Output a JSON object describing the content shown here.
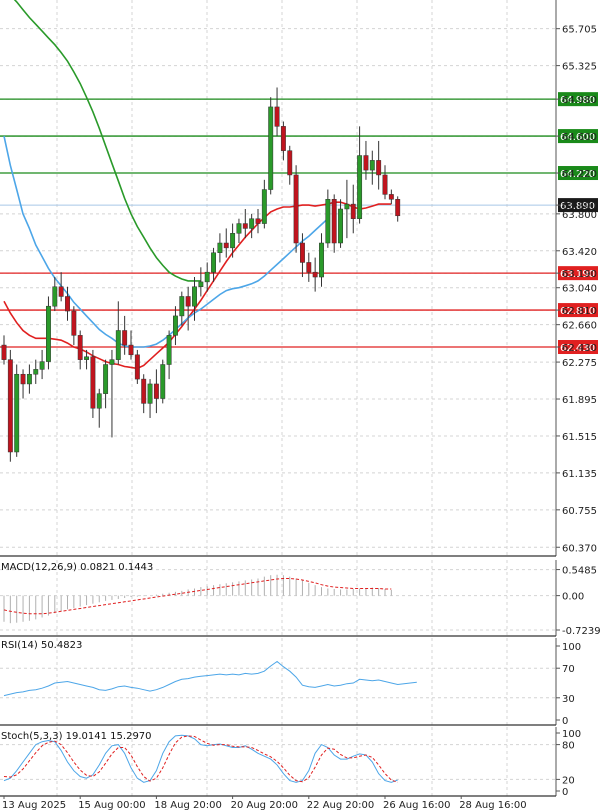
{
  "chart_data": [
    {
      "type": "candlestick",
      "pane": "price",
      "y_ticks": [
        65.705,
        65.325,
        64.98,
        64.6,
        64.22,
        63.89,
        63.8,
        63.42,
        63.19,
        63.04,
        62.81,
        62.66,
        62.43,
        62.275,
        61.895,
        61.515,
        61.135,
        60.755,
        60.37
      ],
      "y_tick_labels": [
        "65.705",
        "65.325",
        "64.980",
        "64.600",
        "64.220",
        "63.890",
        "63.800",
        "63.420",
        "63.190",
        "63.040",
        "62.810",
        "62.660",
        "62.430",
        "62.275",
        "61.895",
        "61.515",
        "61.135",
        "60.755",
        "60.370"
      ],
      "ylim": [
        60.28,
        66.0
      ],
      "x_labels": [
        "13 Aug 2025",
        "15 Aug 00:00",
        "18 Aug 20:00",
        "20 Aug 20:00",
        "22 Aug 20:00",
        "26 Aug 16:00",
        "28 Aug 16:00"
      ],
      "x_label_index": [
        0,
        12,
        24,
        36,
        48,
        60,
        72
      ],
      "levels": [
        {
          "value": 64.98,
          "label": "64.980",
          "color": "#1a8a1a"
        },
        {
          "value": 64.6,
          "label": "64.600",
          "color": "#1a8a1a"
        },
        {
          "value": 64.22,
          "label": "64.220",
          "color": "#1a8a1a"
        },
        {
          "value": 63.19,
          "label": "63.190",
          "color": "#e02020"
        },
        {
          "value": 62.81,
          "label": "62.810",
          "color": "#e02020"
        },
        {
          "value": 62.43,
          "label": "62.430",
          "color": "#e02020"
        }
      ],
      "current_price": {
        "value": 63.89,
        "label": "63.890"
      },
      "candles": [
        {
          "o": 62.45,
          "h": 62.55,
          "l": 62.25,
          "c": 62.3
        },
        {
          "o": 62.3,
          "h": 62.4,
          "l": 61.25,
          "c": 61.35
        },
        {
          "o": 61.35,
          "h": 62.25,
          "l": 61.3,
          "c": 62.15
        },
        {
          "o": 62.15,
          "h": 62.2,
          "l": 61.9,
          "c": 62.05
        },
        {
          "o": 62.05,
          "h": 62.25,
          "l": 61.95,
          "c": 62.15
        },
        {
          "o": 62.15,
          "h": 62.3,
          "l": 62.05,
          "c": 62.2
        },
        {
          "o": 62.2,
          "h": 62.4,
          "l": 62.1,
          "c": 62.28
        },
        {
          "o": 62.28,
          "h": 62.95,
          "l": 62.2,
          "c": 62.85
        },
        {
          "o": 62.85,
          "h": 63.15,
          "l": 62.8,
          "c": 63.05
        },
        {
          "o": 63.05,
          "h": 63.2,
          "l": 62.9,
          "c": 62.95
        },
        {
          "o": 62.95,
          "h": 63.05,
          "l": 62.7,
          "c": 62.8
        },
        {
          "o": 62.8,
          "h": 62.85,
          "l": 62.45,
          "c": 62.55
        },
        {
          "o": 62.55,
          "h": 62.6,
          "l": 62.2,
          "c": 62.3
        },
        {
          "o": 62.3,
          "h": 62.4,
          "l": 62.2,
          "c": 62.33
        },
        {
          "o": 62.33,
          "h": 62.4,
          "l": 61.7,
          "c": 61.8
        },
        {
          "o": 61.8,
          "h": 62.0,
          "l": 61.6,
          "c": 61.95
        },
        {
          "o": 61.95,
          "h": 62.3,
          "l": 61.8,
          "c": 62.25
        },
        {
          "o": 62.25,
          "h": 62.4,
          "l": 61.5,
          "c": 62.3
        },
        {
          "o": 62.3,
          "h": 62.9,
          "l": 62.25,
          "c": 62.6
        },
        {
          "o": 62.6,
          "h": 62.75,
          "l": 62.35,
          "c": 62.45
        },
        {
          "o": 62.45,
          "h": 62.6,
          "l": 62.3,
          "c": 62.35
        },
        {
          "o": 62.35,
          "h": 62.4,
          "l": 62.05,
          "c": 62.1
        },
        {
          "o": 62.1,
          "h": 62.15,
          "l": 61.75,
          "c": 61.85
        },
        {
          "o": 61.85,
          "h": 62.1,
          "l": 61.7,
          "c": 62.05
        },
        {
          "o": 62.05,
          "h": 62.2,
          "l": 61.75,
          "c": 61.9
        },
        {
          "o": 61.9,
          "h": 62.3,
          "l": 61.85,
          "c": 62.25
        },
        {
          "o": 62.25,
          "h": 62.6,
          "l": 62.1,
          "c": 62.55
        },
        {
          "o": 62.55,
          "h": 62.85,
          "l": 62.45,
          "c": 62.75
        },
        {
          "o": 62.75,
          "h": 63.0,
          "l": 62.65,
          "c": 62.95
        },
        {
          "o": 62.95,
          "h": 63.05,
          "l": 62.6,
          "c": 62.85
        },
        {
          "o": 62.85,
          "h": 63.15,
          "l": 62.7,
          "c": 63.05
        },
        {
          "o": 63.05,
          "h": 63.25,
          "l": 62.95,
          "c": 63.1
        },
        {
          "o": 63.1,
          "h": 63.3,
          "l": 63.0,
          "c": 63.2
        },
        {
          "o": 63.2,
          "h": 63.45,
          "l": 63.1,
          "c": 63.4
        },
        {
          "o": 63.4,
          "h": 63.6,
          "l": 63.3,
          "c": 63.5
        },
        {
          "o": 63.5,
          "h": 63.65,
          "l": 63.35,
          "c": 63.45
        },
        {
          "o": 63.45,
          "h": 63.7,
          "l": 63.35,
          "c": 63.6
        },
        {
          "o": 63.6,
          "h": 63.75,
          "l": 63.5,
          "c": 63.7
        },
        {
          "o": 63.7,
          "h": 63.85,
          "l": 63.55,
          "c": 63.65
        },
        {
          "o": 63.65,
          "h": 63.8,
          "l": 63.55,
          "c": 63.75
        },
        {
          "o": 63.75,
          "h": 63.85,
          "l": 63.6,
          "c": 63.7
        },
        {
          "o": 63.7,
          "h": 64.15,
          "l": 63.65,
          "c": 64.05
        },
        {
          "o": 64.05,
          "h": 65.0,
          "l": 64.0,
          "c": 64.9
        },
        {
          "o": 64.9,
          "h": 65.1,
          "l": 64.6,
          "c": 64.7
        },
        {
          "o": 64.7,
          "h": 64.75,
          "l": 64.35,
          "c": 64.45
        },
        {
          "o": 64.45,
          "h": 64.5,
          "l": 64.1,
          "c": 64.2
        },
        {
          "o": 64.2,
          "h": 64.3,
          "l": 63.4,
          "c": 63.5
        },
        {
          "o": 63.5,
          "h": 63.6,
          "l": 63.15,
          "c": 63.3
        },
        {
          "o": 63.3,
          "h": 63.4,
          "l": 63.1,
          "c": 63.2
        },
        {
          "o": 63.2,
          "h": 63.35,
          "l": 63.0,
          "c": 63.15
        },
        {
          "o": 63.15,
          "h": 63.6,
          "l": 63.05,
          "c": 63.5
        },
        {
          "o": 63.5,
          "h": 64.05,
          "l": 63.45,
          "c": 63.95
        },
        {
          "o": 63.95,
          "h": 64.0,
          "l": 63.4,
          "c": 63.5
        },
        {
          "o": 63.5,
          "h": 63.95,
          "l": 63.45,
          "c": 63.85
        },
        {
          "o": 63.85,
          "h": 64.15,
          "l": 63.55,
          "c": 63.9
        },
        {
          "o": 63.9,
          "h": 64.1,
          "l": 63.6,
          "c": 63.75
        },
        {
          "o": 63.75,
          "h": 64.7,
          "l": 63.7,
          "c": 64.4
        },
        {
          "o": 64.4,
          "h": 64.55,
          "l": 64.15,
          "c": 64.25
        },
        {
          "o": 64.25,
          "h": 64.45,
          "l": 64.1,
          "c": 64.35
        },
        {
          "o": 64.35,
          "h": 64.55,
          "l": 64.05,
          "c": 64.2
        },
        {
          "o": 64.2,
          "h": 64.3,
          "l": 63.95,
          "c": 64.0
        },
        {
          "o": 64.0,
          "h": 64.05,
          "l": 63.9,
          "c": 63.95
        },
        {
          "o": 63.95,
          "h": 63.98,
          "l": 63.72,
          "c": 63.78
        }
      ],
      "series": [
        {
          "name": "",
          "color": "#e02020",
          "x_start": 0,
          "values": [
            62.9,
            62.78,
            62.68,
            62.6,
            62.55,
            62.52,
            62.52,
            62.52,
            62.51,
            62.5,
            62.47,
            62.43,
            62.41,
            62.38,
            62.34,
            62.31,
            62.28,
            62.26,
            62.25,
            62.23,
            62.22,
            62.21,
            62.24,
            62.3,
            62.36,
            62.42,
            62.48,
            62.56,
            62.64,
            62.73,
            62.82,
            62.91,
            63.01,
            63.11,
            63.21,
            63.31,
            63.4,
            63.48,
            63.56,
            63.63,
            63.7,
            63.76,
            63.82,
            63.85,
            63.87,
            63.87,
            63.88,
            63.89,
            63.89,
            63.88,
            63.89,
            63.9,
            63.92,
            63.92,
            63.9,
            63.87,
            63.85,
            63.86,
            63.88,
            63.9,
            63.9,
            63.9
          ]
        },
        {
          "name": "",
          "color": "#4da6e8",
          "x_start": 0,
          "values": [
            64.6,
            64.3,
            64.05,
            63.8,
            63.65,
            63.48,
            63.36,
            63.24,
            63.14,
            63.06,
            62.98,
            62.89,
            62.82,
            62.75,
            62.68,
            62.61,
            62.56,
            62.52,
            62.47,
            62.44,
            62.43,
            62.43,
            62.43,
            62.44,
            62.46,
            62.5,
            62.55,
            62.61,
            62.67,
            62.73,
            62.78,
            62.82,
            62.87,
            62.92,
            62.97,
            63.01,
            63.03,
            63.04,
            63.06,
            63.08,
            63.11,
            63.16,
            63.22,
            63.28,
            63.34,
            63.4,
            63.46,
            63.52,
            63.57,
            63.63,
            63.69,
            63.75
          ]
        },
        {
          "name": "",
          "color": "#2a9a2a",
          "x_start": 0,
          "values": [
            66.1,
            66.05,
            65.98,
            65.9,
            65.82,
            65.75,
            65.68,
            65.61,
            65.54,
            65.46,
            65.37,
            65.26,
            65.14,
            65.0,
            64.85,
            64.68,
            64.5,
            64.32,
            64.14,
            63.96,
            63.8,
            63.67,
            63.56,
            63.45,
            63.35,
            63.27,
            63.2,
            63.16,
            63.13,
            63.11,
            63.11,
            63.11
          ]
        }
      ]
    },
    {
      "type": "bar",
      "pane": "macd",
      "label": "MACD(12,26,9) 0.0821 0.1443",
      "y_ticks": [
        0.5485,
        0.0,
        -0.7239
      ],
      "y_tick_labels": [
        "0.5485",
        "0.00",
        "-0.7239"
      ],
      "ylim": [
        -0.85,
        0.75
      ],
      "histogram_x_start": 0,
      "histogram": [
        -0.55,
        -0.58,
        -0.57,
        -0.55,
        -0.53,
        -0.5,
        -0.46,
        -0.42,
        -0.37,
        -0.33,
        -0.29,
        -0.26,
        -0.23,
        -0.2,
        -0.17,
        -0.14,
        -0.11,
        -0.09,
        -0.07,
        -0.05,
        -0.03,
        -0.02,
        -0.01,
        0.0,
        0.02,
        0.04,
        0.06,
        0.08,
        0.1,
        0.13,
        0.15,
        0.18,
        0.2,
        0.22,
        0.24,
        0.26,
        0.28,
        0.3,
        0.32,
        0.34,
        0.36,
        0.4,
        0.43,
        0.44,
        0.43,
        0.4,
        0.36,
        0.32,
        0.27,
        0.22,
        0.18,
        0.15,
        0.14,
        0.13,
        0.13,
        0.14,
        0.15,
        0.16,
        0.17,
        0.16,
        0.14,
        0.12
      ],
      "signal_x_start": 0,
      "signal": [
        -0.3,
        -0.33,
        -0.35,
        -0.37,
        -0.38,
        -0.38,
        -0.38,
        -0.37,
        -0.35,
        -0.33,
        -0.31,
        -0.29,
        -0.27,
        -0.25,
        -0.23,
        -0.21,
        -0.19,
        -0.17,
        -0.15,
        -0.13,
        -0.11,
        -0.09,
        -0.07,
        -0.05,
        -0.03,
        -0.01,
        0.01,
        0.03,
        0.05,
        0.07,
        0.09,
        0.11,
        0.13,
        0.15,
        0.17,
        0.19,
        0.21,
        0.23,
        0.25,
        0.27,
        0.29,
        0.31,
        0.33,
        0.35,
        0.36,
        0.36,
        0.35,
        0.33,
        0.3,
        0.27,
        0.23,
        0.2,
        0.18,
        0.17,
        0.16,
        0.15,
        0.15,
        0.15,
        0.15,
        0.15,
        0.14,
        0.14
      ],
      "histogram_color": "#b0b0b0",
      "signal_color": "#e02020"
    },
    {
      "type": "line",
      "pane": "rsi",
      "label": "RSI(14) 50.4823",
      "y_ticks": [
        100,
        70,
        30,
        0
      ],
      "y_tick_labels": [
        "100",
        "70",
        "30",
        "0"
      ],
      "ylim": [
        0,
        100
      ],
      "x_start": 0,
      "values": [
        33,
        35,
        37,
        38,
        40,
        41,
        43,
        46,
        50,
        51,
        52,
        50,
        48,
        46,
        44,
        41,
        40,
        42,
        45,
        46,
        44,
        43,
        41,
        39,
        41,
        44,
        48,
        52,
        55,
        56,
        58,
        59,
        60,
        61,
        62,
        61,
        62,
        61,
        63,
        62,
        63,
        66,
        73,
        79,
        72,
        66,
        58,
        47,
        45,
        44,
        46,
        48,
        46,
        47,
        49,
        50,
        55,
        54,
        53,
        54,
        52,
        50,
        48,
        49,
        50,
        51
      ],
      "color": "#4da6e8"
    },
    {
      "type": "line",
      "pane": "stoch",
      "label": "Stoch(5,3,3) 19.0141 15.2970",
      "y_ticks": [
        100,
        80,
        20,
        0
      ],
      "y_tick_labels": [
        "100",
        "80",
        "20",
        "0"
      ],
      "ylim": [
        0,
        100
      ],
      "series": [
        {
          "name": "",
          "color": "#4da6e8",
          "x_start": 0,
          "values": [
            18,
            22,
            35,
            50,
            65,
            80,
            85,
            87,
            85,
            70,
            50,
            35,
            25,
            22,
            28,
            45,
            65,
            78,
            80,
            65,
            40,
            22,
            15,
            18,
            35,
            65,
            85,
            95,
            96,
            95,
            90,
            80,
            78,
            80,
            81,
            78,
            75,
            75,
            78,
            72,
            65,
            60,
            55,
            45,
            30,
            18,
            15,
            18,
            35,
            65,
            80,
            75,
            62,
            55,
            55,
            60,
            64,
            62,
            50,
            30,
            18,
            15,
            19
          ]
        },
        {
          "name": "",
          "color": "#e02020",
          "x_start": 0,
          "values": [
            25,
            24,
            28,
            38,
            52,
            66,
            78,
            84,
            86,
            80,
            66,
            50,
            36,
            27,
            25,
            33,
            48,
            64,
            75,
            75,
            62,
            42,
            25,
            17,
            22,
            40,
            63,
            83,
            93,
            95,
            94,
            88,
            82,
            79,
            80,
            80,
            77,
            76,
            76,
            75,
            70,
            64,
            59,
            51,
            40,
            27,
            18,
            16,
            23,
            41,
            62,
            74,
            72,
            63,
            57,
            57,
            60,
            62,
            58,
            45,
            30,
            19,
            15
          ]
        }
      ]
    }
  ]
}
